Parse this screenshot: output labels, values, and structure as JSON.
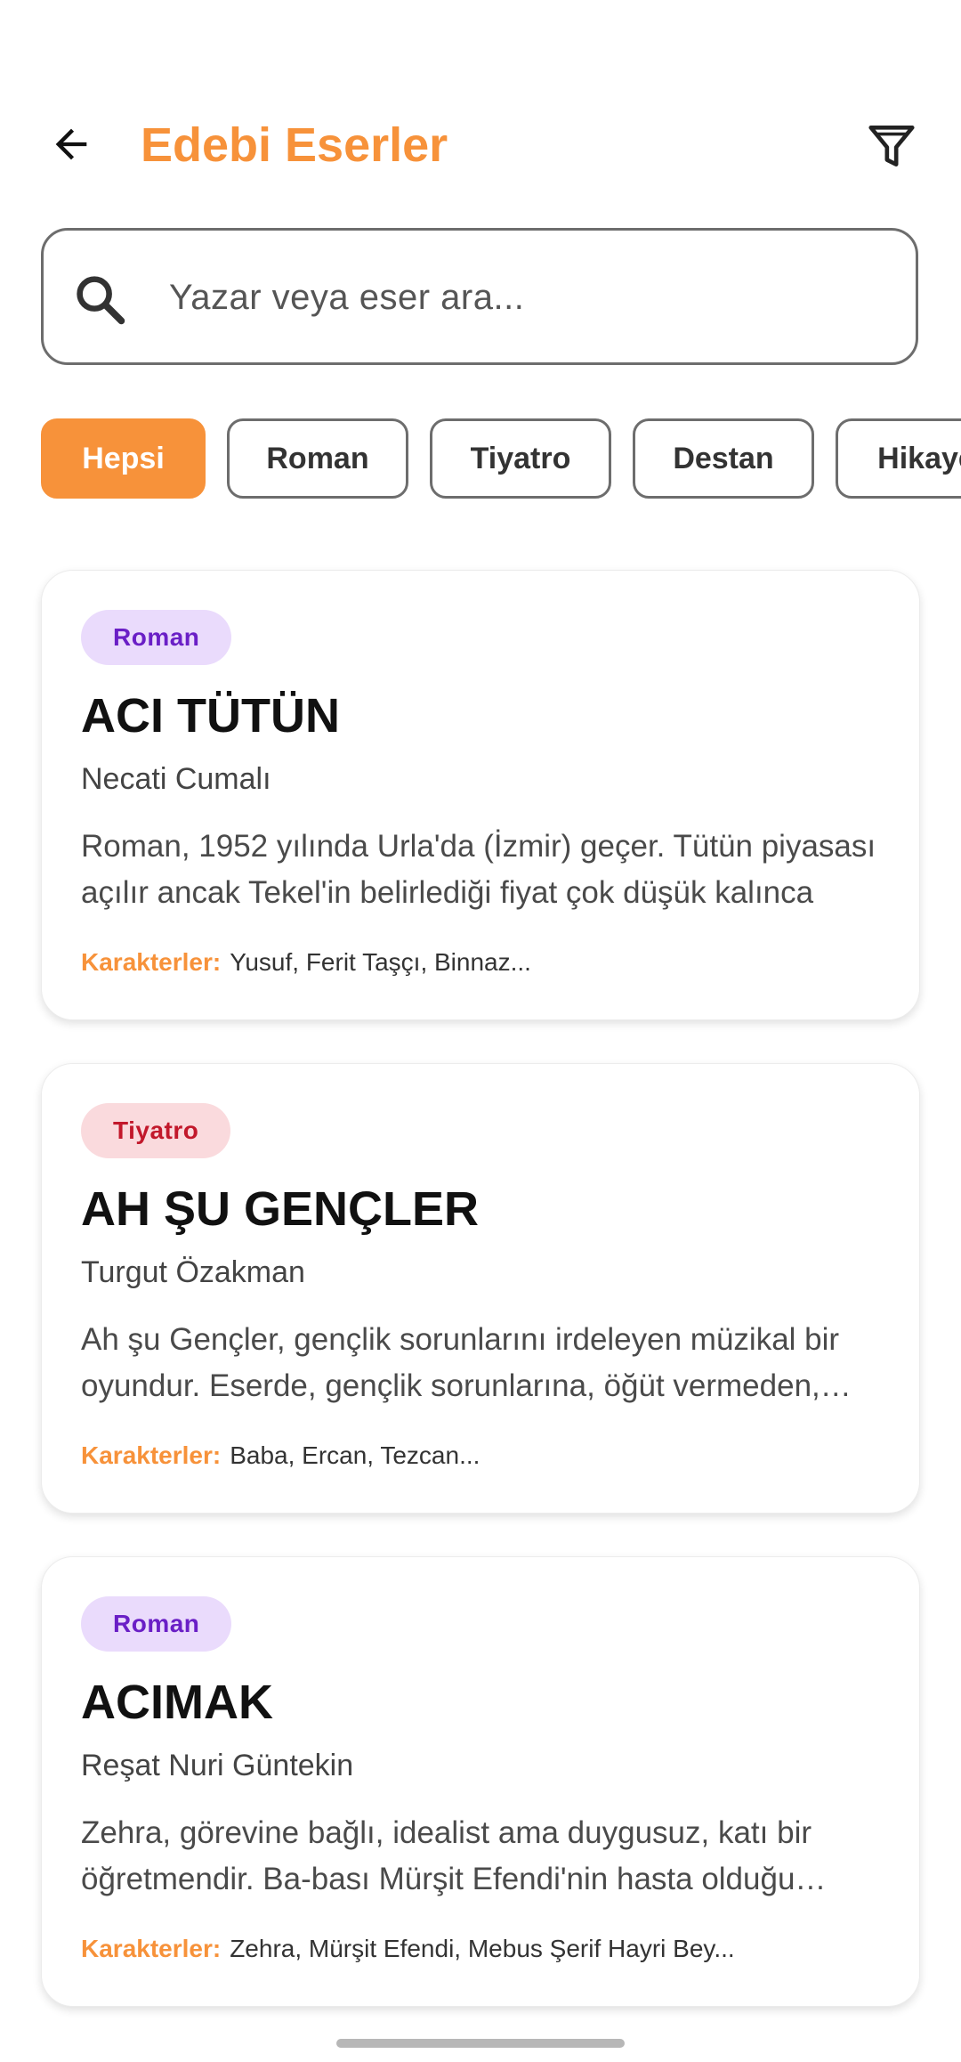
{
  "app_bar": {
    "title": "Edebi Eserler",
    "back_icon": "arrow-left-icon",
    "filter_icon": "filter-icon"
  },
  "search": {
    "placeholder": "Yazar veya eser ara...",
    "value": "",
    "icon": "search-icon"
  },
  "filters": {
    "selected": "Hepsi",
    "chips": [
      "Hepsi",
      "Roman",
      "Tiyatro",
      "Destan",
      "Hikaye"
    ]
  },
  "colors": {
    "accent": "#f7923a",
    "roman_badge_bg": "#eadbfc",
    "roman_badge_text": "#6a1fc6",
    "tiyatro_badge_bg": "#fadadd",
    "tiyatro_badge_text": "#c2182b"
  },
  "works": [
    {
      "category": "Roman",
      "title": "ACI TÜTÜN",
      "author": "Necati Cumalı",
      "description": "Roman, 1952 yılında Urla'da (İzmir) geçer. Tütün piyasası açılır ancak Tekel'in belirlediği fiyat çok düşük kalınca",
      "characters_label": "Karakterler:",
      "characters": "Yusuf, Ferit Taşçı, Binnaz..."
    },
    {
      "category": "Tiyatro",
      "title": "AH ŞU GENÇLER",
      "author": "Turgut Özakman",
      "description": "Ah şu Gençler, gençlik sorunlarını irdeleyen müzikal bir oyundur. Eserde, gençlik sorunlarına, öğüt vermeden, tartışmaya",
      "characters_label": "Karakterler:",
      "characters": "Baba, Ercan, Tezcan..."
    },
    {
      "category": "Roman",
      "title": "ACIMAK",
      "author": "Reşat Nuri Güntekin",
      "description": "Zehra, görevine bağlı, idealist ama duygusuz, katı bir öğretmendir. Ba-bası Mürşit Efendi'nin hasta olduğu haberini alınca",
      "characters_label": "Karakterler:",
      "characters": "Zehra, Mürşit Efendi, Mebus Şerif Hayri Bey..."
    }
  ]
}
